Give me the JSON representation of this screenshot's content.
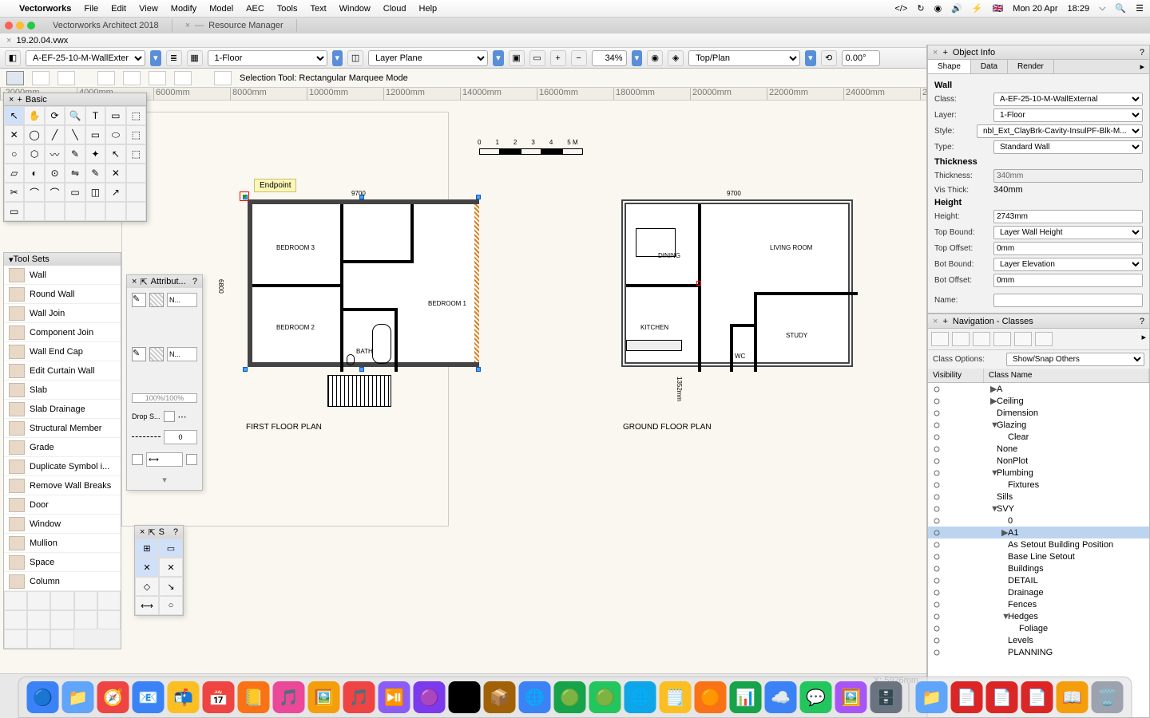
{
  "menubar": {
    "app": "Vectorworks",
    "items": [
      "File",
      "Edit",
      "View",
      "Modify",
      "Model",
      "AEC",
      "Tools",
      "Text",
      "Window",
      "Cloud",
      "Help"
    ],
    "right": {
      "flag": "🇬🇧",
      "date": "Mon 20 Apr",
      "time": "18:29"
    }
  },
  "tabs": [
    {
      "label": "Vectorworks Architect 2018",
      "active": false
    },
    {
      "label": "Resource Manager",
      "active": false
    }
  ],
  "doc_title": "19.20.04.vwx",
  "toolbar": {
    "class_sel": "A-EF-25-10-M-WallExternal",
    "layer_sel": "1-Floor",
    "plane_sel": "Layer Plane",
    "zoom": "34%",
    "view": "Top/Plan",
    "angle": "0.00°"
  },
  "modebar": {
    "hint": "Selection Tool: Rectangular Marquee Mode"
  },
  "palette": {
    "title": "Basic"
  },
  "toolsets": {
    "title": "Tool Sets",
    "items": [
      "Wall",
      "Round Wall",
      "Wall Join",
      "Component Join",
      "Wall End Cap",
      "Edit Curtain Wall",
      "Slab",
      "Slab Drainage",
      "Structural Member",
      "Grade",
      "Duplicate Symbol i...",
      "Remove Wall Breaks",
      "Door",
      "Window",
      "Mullion",
      "Space",
      "Column"
    ]
  },
  "attributes": {
    "title": "Attribut...",
    "fill": "N...",
    "pen": "N...",
    "opacity": "100%/100%",
    "drop": "Drop S...",
    "line": "0"
  },
  "snap": {
    "title": "S"
  },
  "obj_info": {
    "title": "Object Info",
    "tabs": [
      "Shape",
      "Data",
      "Render"
    ],
    "type": "Wall",
    "class": "A-EF-25-10-M-WallExternal",
    "layer": "1-Floor",
    "style": "nbl_Ext_ClayBrk-Cavity-InsulPF-Blk-M...",
    "wall_type": "Standard Wall",
    "thickness": "340mm",
    "vis_thick": "340mm",
    "height": "2743mm",
    "top_bound": "Layer Wall Height",
    "top_offset": "0mm",
    "bot_bound": "Layer Elevation",
    "bot_offset": "0mm",
    "name": ""
  },
  "nav": {
    "title": "Navigation - Classes",
    "class_options": "Show/Snap Others",
    "cols": [
      "Visibility",
      "Class Name"
    ],
    "rows": [
      {
        "lvl": 0,
        "tri": "▶",
        "name": "A"
      },
      {
        "lvl": 0,
        "tri": "▶",
        "name": "Ceiling"
      },
      {
        "lvl": 0,
        "tri": "",
        "name": "Dimension"
      },
      {
        "lvl": 0,
        "tri": "▼",
        "name": "Glazing"
      },
      {
        "lvl": 1,
        "tri": "",
        "name": "Clear"
      },
      {
        "lvl": 0,
        "tri": "",
        "name": "None"
      },
      {
        "lvl": 0,
        "tri": "",
        "name": "NonPlot"
      },
      {
        "lvl": 0,
        "tri": "▼",
        "name": "Plumbing"
      },
      {
        "lvl": 1,
        "tri": "",
        "name": "Fixtures"
      },
      {
        "lvl": 0,
        "tri": "",
        "name": "Sills"
      },
      {
        "lvl": 0,
        "tri": "▼",
        "name": "SVY"
      },
      {
        "lvl": 1,
        "tri": "",
        "name": "0"
      },
      {
        "lvl": 1,
        "tri": "▶",
        "name": "A1",
        "sel": true
      },
      {
        "lvl": 1,
        "tri": "",
        "name": "As Setout Building Position"
      },
      {
        "lvl": 1,
        "tri": "",
        "name": "Base Line Setout"
      },
      {
        "lvl": 1,
        "tri": "",
        "name": "Buildings"
      },
      {
        "lvl": 1,
        "tri": "",
        "name": "DETAIL"
      },
      {
        "lvl": 1,
        "tri": "",
        "name": "Drainage"
      },
      {
        "lvl": 1,
        "tri": "",
        "name": "Fences"
      },
      {
        "lvl": 1,
        "tri": "▼",
        "name": "Hedges"
      },
      {
        "lvl": 2,
        "tri": "",
        "name": "Foliage"
      },
      {
        "lvl": 1,
        "tri": "",
        "name": "Levels"
      },
      {
        "lvl": 1,
        "tri": "",
        "name": "PLANNING"
      }
    ]
  },
  "drawing": {
    "tooltip": "Endpoint",
    "scale_labels": [
      "0",
      "1",
      "2",
      "3",
      "4",
      "5 M"
    ],
    "first_floor": {
      "title": "FIRST FLOOR PLAN",
      "dim_w": "9700",
      "dim_h": "6800",
      "rooms": [
        "BEDROOM 3",
        "BEDROOM 2",
        "BATH",
        "BEDROOM 1"
      ]
    },
    "ground_floor": {
      "title": "GROUND FLOOR PLAN",
      "dim_w": "9700",
      "dim_h": "1352mm",
      "rooms": [
        "DINING",
        "KITCHEN",
        "LIVING ROOM",
        "STUDY",
        "WC"
      ]
    }
  },
  "status": {
    "x": "X:  5926mm"
  },
  "dock_icons": [
    "🔵",
    "📁",
    "🧭",
    "📧",
    "📬",
    "📅",
    "📒",
    "🎵",
    "🖼️",
    "🎵",
    "⏯️",
    "🟣",
    "Ⓥ",
    "📦",
    "🌐",
    "🟢",
    "🟢",
    "🌐",
    "🗒️",
    "🟠",
    "📊",
    "☁️",
    "💬",
    "🖼️",
    "🗄️",
    "📁",
    "📄",
    "📄",
    "📄",
    "📖",
    "🗑️"
  ]
}
